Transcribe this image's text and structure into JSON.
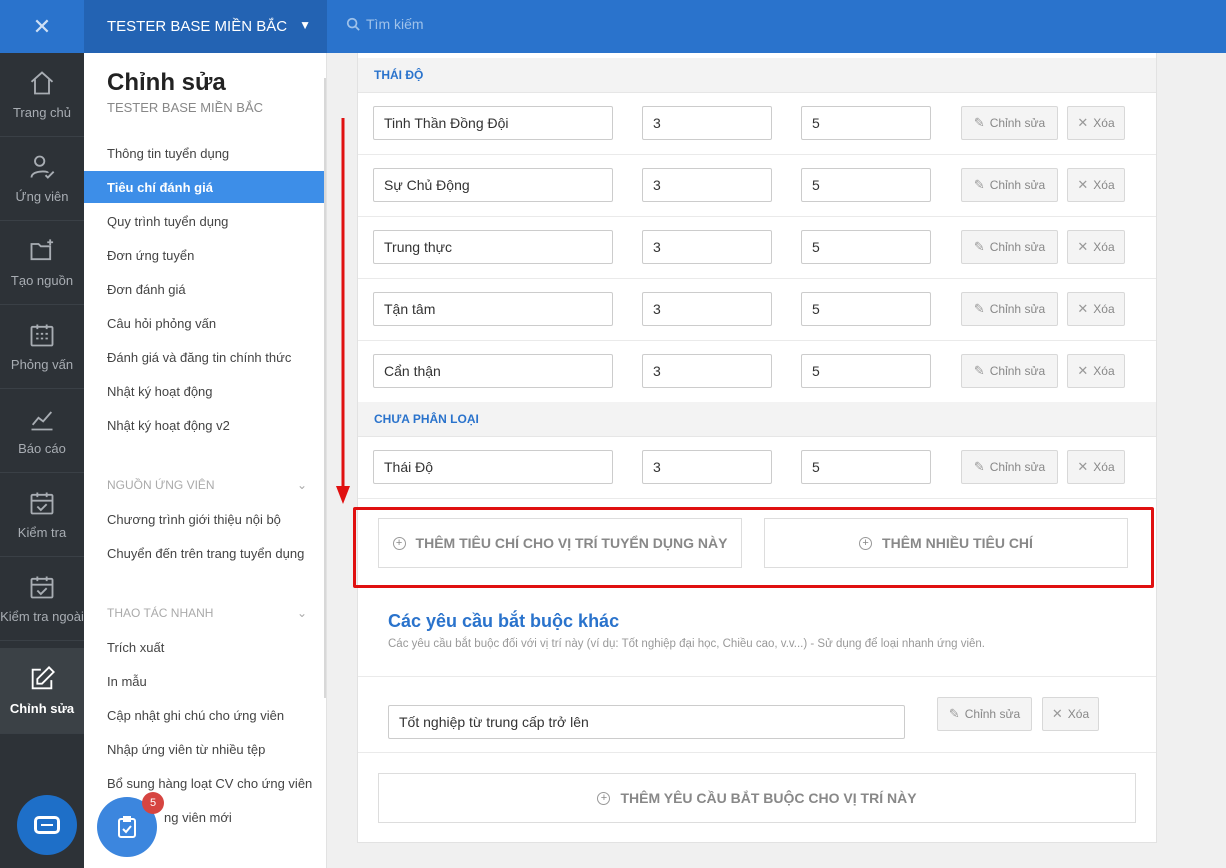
{
  "rail": {
    "items": [
      {
        "label": "Trang chủ",
        "icon": "home-icon"
      },
      {
        "label": "Ứng viên",
        "icon": "user-check-icon"
      },
      {
        "label": "Tạo nguồn",
        "icon": "folder-plus-icon"
      },
      {
        "label": "Phỏng vấn",
        "icon": "calendar-grid-icon"
      },
      {
        "label": "Báo cáo",
        "icon": "chart-line-icon"
      },
      {
        "label": "Kiểm tra",
        "icon": "calendar-check-icon"
      },
      {
        "label": "Kiểm tra ngoài",
        "icon": "calendar-check-icon"
      },
      {
        "label": "Chỉnh sửa",
        "icon": "edit-icon"
      }
    ],
    "badge_count": "5"
  },
  "topbar": {
    "company": "TESTER BASE MIỀN BẮC",
    "search_placeholder": "Tìm kiếm"
  },
  "sidebar": {
    "title": "Chỉnh sửa",
    "subtitle": "TESTER BASE MIỀN BẮC",
    "links": [
      "Thông tin tuyển dụng",
      "Tiêu chí đánh giá",
      "Quy trình tuyển dụng",
      "Đơn ứng tuyển",
      "Đơn đánh giá",
      "Câu hỏi phỏng vấn",
      "Đánh giá và đăng tin chính thức",
      "Nhật ký hoạt động",
      "Nhật ký hoạt động v2"
    ],
    "section_sources": "NGUỒN ỨNG VIÊN",
    "source_links": [
      "Chương trình giới thiệu nội bộ",
      "Chuyển đến trên trang tuyển dụng"
    ],
    "section_quick": "THAO TÁC NHANH",
    "quick_links": [
      "Trích xuất",
      "In mẫu",
      "Cập nhật ghi chú cho ứng viên",
      "Nhập ứng viên từ nhiều tệp",
      "Bổ sung hàng loạt CV cho ứng viên",
      "ng viên mới"
    ]
  },
  "main": {
    "group_attitude": "THÁI ĐỘ",
    "attitude_rows": [
      {
        "name": "Tinh Thần Đồng Đội",
        "weight": "3",
        "max": "5"
      },
      {
        "name": "Sự Chủ Động",
        "weight": "3",
        "max": "5"
      },
      {
        "name": "Trung thực",
        "weight": "3",
        "max": "5"
      },
      {
        "name": "Tận tâm",
        "weight": "3",
        "max": "5"
      },
      {
        "name": "Cẩn thận",
        "weight": "3",
        "max": "5"
      }
    ],
    "group_uncategorized": "CHƯA PHÂN LOẠI",
    "uncategorized_rows": [
      {
        "name": "Thái Độ",
        "weight": "3",
        "max": "5"
      }
    ],
    "edit_label": "Chỉnh sửa",
    "delete_label": "Xóa",
    "add_criterion": "THÊM TIÊU CHÍ CHO VỊ TRÍ TUYỂN DỤNG NÀY",
    "add_many": "THÊM NHIỀU TIÊU CHÍ",
    "req_title": "Các yêu cầu bắt buộc khác",
    "req_desc": "Các yêu cầu bắt buộc đối với vị trí này (ví dụ: Tốt nghiệp đại học, Chiều cao, v.v...) - Sử dụng để loại nhanh ứng viên.",
    "requirement": "Tốt nghiệp từ trung cấp trở lên",
    "add_requirement": "THÊM YÊU CẦU BẮT BUỘC CHO VỊ TRÍ NÀY"
  },
  "colors": {
    "brand": "#2a73cc",
    "annotation": "#e01010"
  }
}
